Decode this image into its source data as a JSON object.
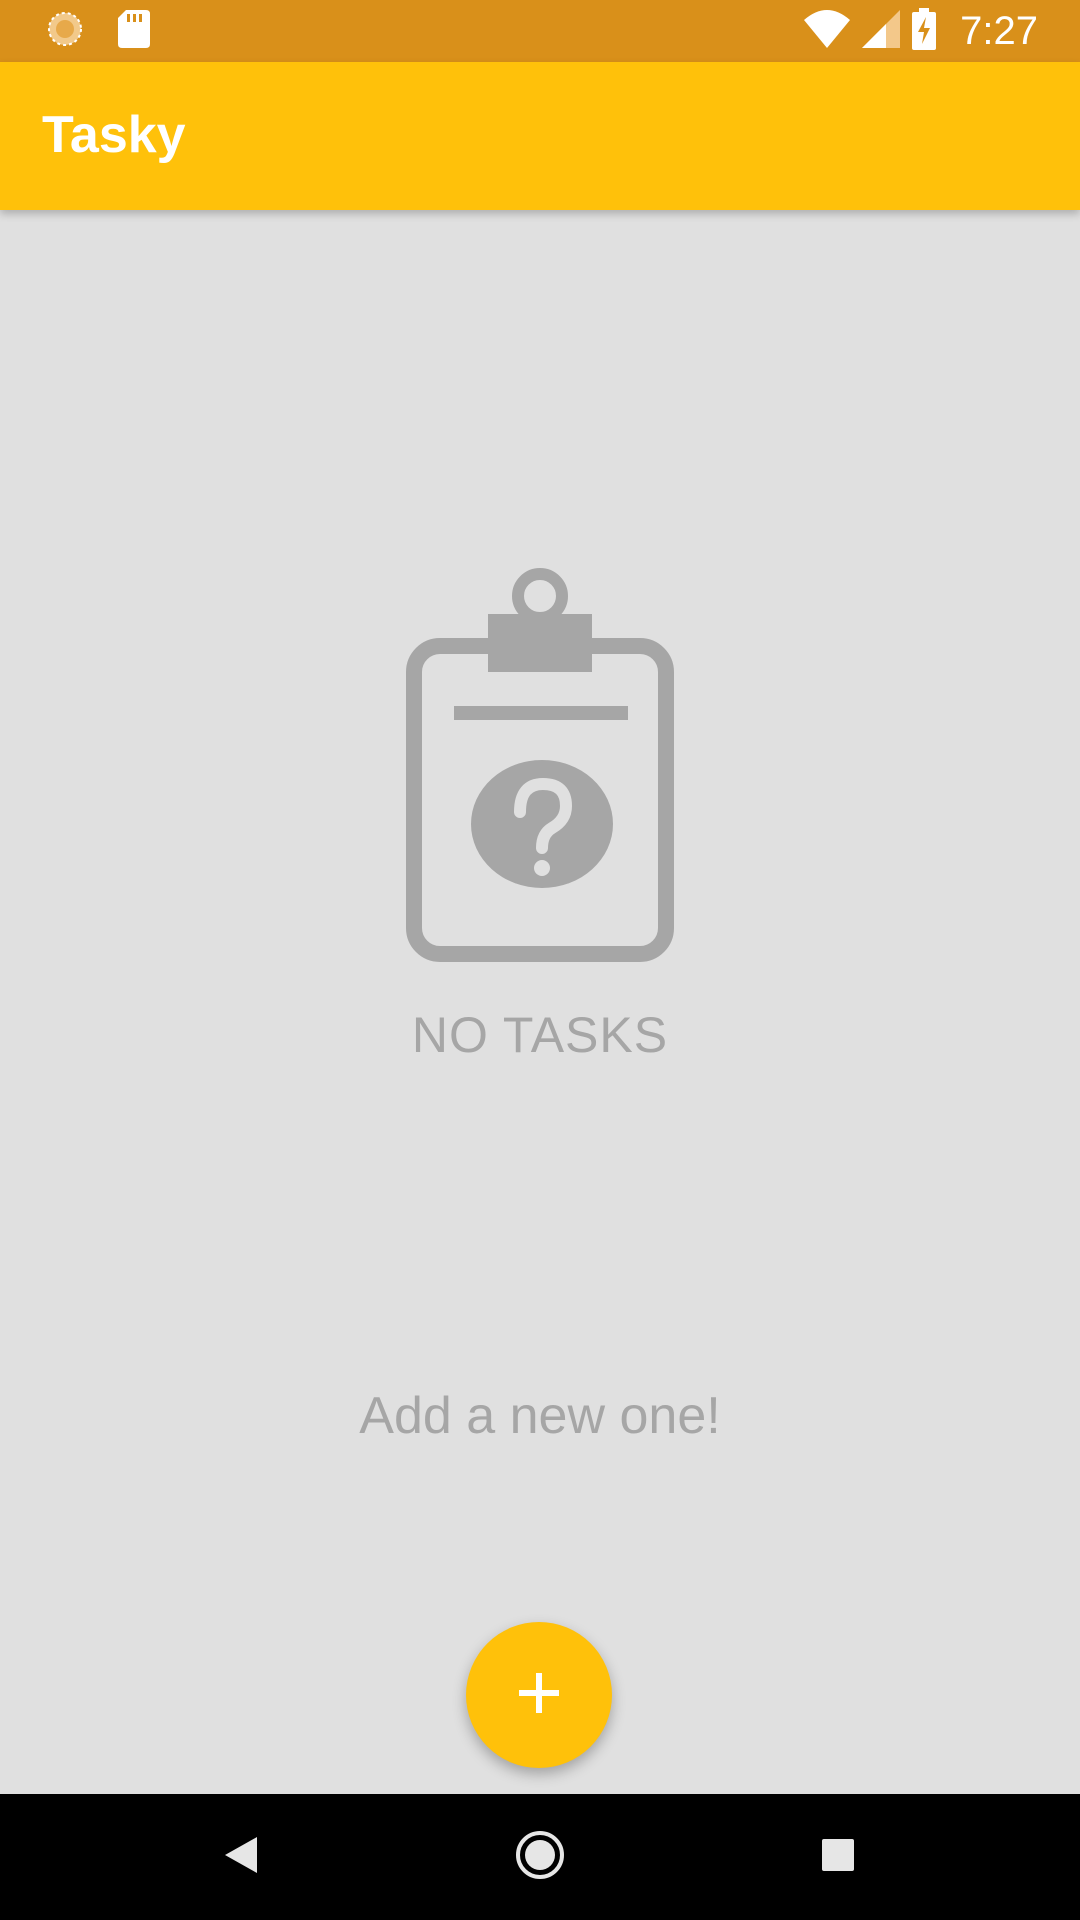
{
  "status_bar": {
    "time": "7:27",
    "icons": [
      "sync-icon",
      "sd-card-icon",
      "wifi-icon",
      "cell-signal-icon",
      "battery-charging-icon"
    ]
  },
  "app_bar": {
    "title": "Tasky"
  },
  "empty_state": {
    "icon": "clipboard-question-icon",
    "title": "NO TASKS",
    "subtitle": "Add a new one!"
  },
  "fab": {
    "icon": "plus-icon",
    "label": "+"
  },
  "navigation_bar": {
    "buttons": [
      "back-icon",
      "home-icon",
      "recents-icon"
    ]
  },
  "colors": {
    "status_bar": "#d9901a",
    "app_bar": "#ffc10a",
    "accent": "#ffc10a",
    "background": "#e0e0e0",
    "empty_text": "#a6a6a6"
  }
}
